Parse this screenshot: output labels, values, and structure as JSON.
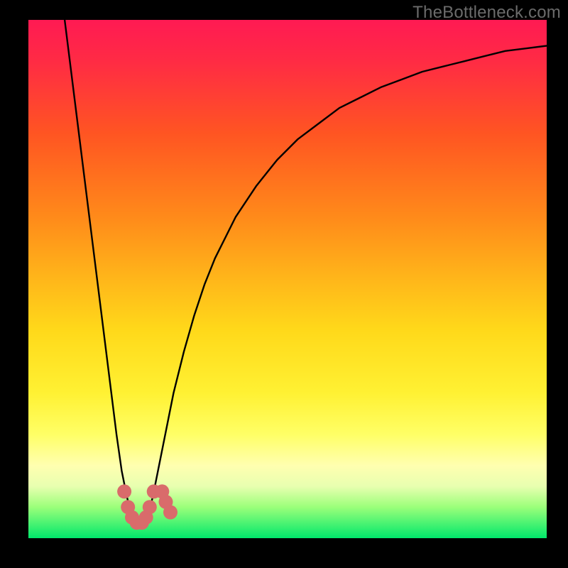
{
  "watermark": "TheBottleneck.com",
  "colors": {
    "frame": "#000000",
    "gradient_top": "#ff1a53",
    "gradient_bottom": "#00e86b",
    "curve": "#000000",
    "markers": "#d96b6b"
  },
  "chart_data": {
    "type": "line",
    "title": "",
    "xlabel": "",
    "ylabel": "",
    "xlim": [
      0,
      100
    ],
    "ylim": [
      0,
      100
    ],
    "series": [
      {
        "name": "curve",
        "x": [
          7,
          8,
          9,
          10,
          11,
          12,
          13,
          14,
          15,
          16,
          17,
          18,
          19,
          20,
          21,
          22,
          23,
          24,
          25,
          26,
          27,
          28,
          30,
          32,
          34,
          36,
          38,
          40,
          44,
          48,
          52,
          56,
          60,
          64,
          68,
          72,
          76,
          80,
          84,
          88,
          92,
          96,
          100
        ],
        "y": [
          100,
          92,
          84,
          76,
          68,
          60,
          52,
          44,
          36,
          28,
          20,
          13,
          8,
          4,
          2,
          2,
          4,
          8,
          13,
          18,
          23,
          28,
          36,
          43,
          49,
          54,
          58,
          62,
          68,
          73,
          77,
          80,
          83,
          85,
          87,
          88.5,
          90,
          91,
          92,
          93,
          94,
          94.5,
          95
        ]
      }
    ],
    "markers": {
      "name": "highlight-points",
      "x": [
        18.5,
        19.2,
        20.0,
        20.9,
        21.9,
        22.7,
        23.4,
        24.2,
        25.8,
        26.5,
        27.4
      ],
      "y": [
        9,
        6,
        4,
        3,
        3,
        4,
        6,
        9,
        9,
        7,
        5
      ]
    },
    "notes": "Single V-shaped bottleneck curve on a vertical red→green gradient. No axis tick labels visible; values above are estimated from relative pixel positions on a 0–100 normalized scale (x = horizontal %, y = vertical % from bottom)."
  }
}
